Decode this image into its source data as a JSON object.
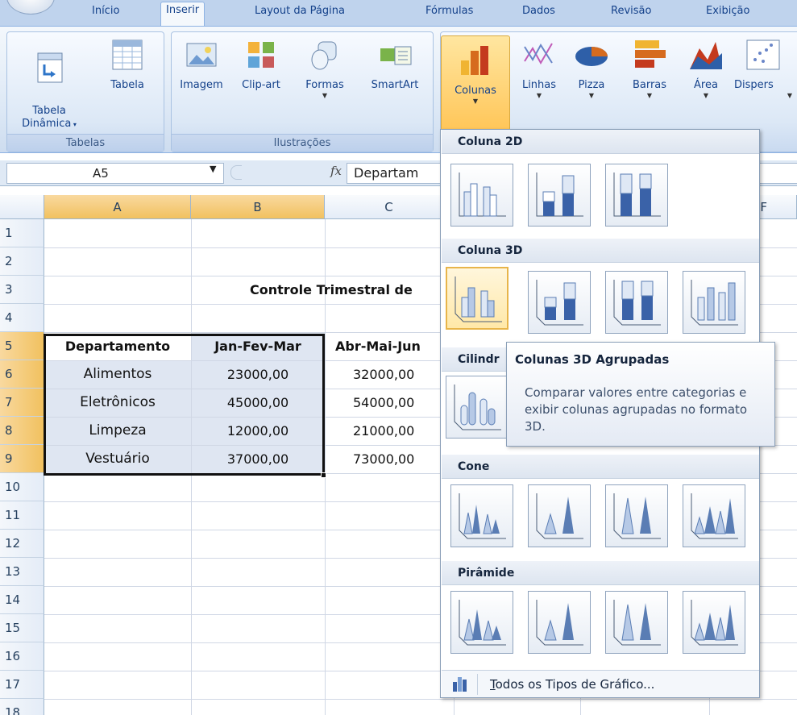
{
  "tabs": [
    "Início",
    "Inserir",
    "Layout da Página",
    "Fórmulas",
    "Dados",
    "Revisão",
    "Exibição"
  ],
  "ribbon": {
    "tabelas": {
      "label": "Tabelas",
      "buttons": [
        "Tabela\nDinâmica",
        "Tabela"
      ]
    },
    "ilustracoes": {
      "label": "Ilustrações",
      "buttons": [
        "Imagem",
        "Clip-art",
        "Formas",
        "SmartArt"
      ]
    },
    "graficos": {
      "buttons": [
        "Colunas",
        "Linhas",
        "Pizza",
        "Barras",
        "Área",
        "Dispers"
      ]
    }
  },
  "formula_bar": {
    "name_box": "A5",
    "fx": "fx",
    "content": "Departam"
  },
  "sheet": {
    "columns": [
      "A",
      "B",
      "C"
    ],
    "rows": [
      "1",
      "2",
      "3",
      "4",
      "5",
      "6",
      "7",
      "8",
      "9",
      "10",
      "11",
      "12",
      "13",
      "14",
      "15",
      "16",
      "17",
      "18"
    ],
    "title": "Controle Trimestral de",
    "headers": [
      "Departamento",
      "Jan-Fev-Mar",
      "Abr-Mai-Jun"
    ],
    "data": [
      [
        "Alimentos",
        "23000,00",
        "32000,00"
      ],
      [
        "Eletrônicos",
        "45000,00",
        "54000,00"
      ],
      [
        "Limpeza",
        "12000,00",
        "21000,00"
      ],
      [
        "Vestuário",
        "37000,00",
        "73000,00"
      ]
    ],
    "partial_col": "F"
  },
  "gallery": {
    "sections": [
      "Coluna 2D",
      "Coluna 3D",
      "Cilindr",
      "Cone",
      "Pirâmide"
    ],
    "all_types_prefix": "T",
    "all_types_rest": "odos os Tipos de Gráfico..."
  },
  "tooltip": {
    "title": "Colunas 3D Agrupadas",
    "body": "Comparar valores entre categorias e exibir colunas agrupadas no formato 3D."
  }
}
